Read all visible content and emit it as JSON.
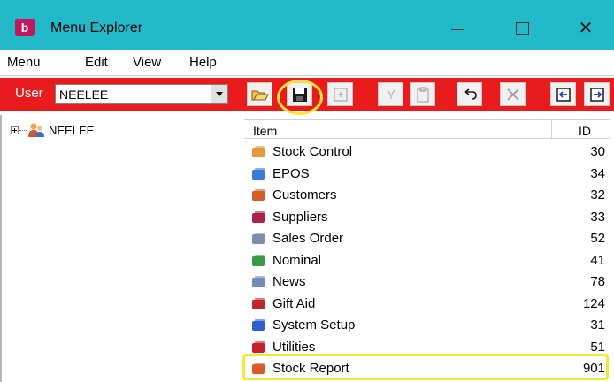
{
  "window": {
    "app_icon_letter": "b",
    "title": "Menu Explorer",
    "close_glyph": "✕"
  },
  "menubar": [
    "Menu",
    "Edit",
    "View",
    "Help"
  ],
  "toolbar": {
    "user_label": "User",
    "user_value": "NEELEE",
    "buttons": [
      "open-folder-icon",
      "save-icon",
      "new-item-icon",
      "filter-icon",
      "clipboard-icon",
      "undo-icon",
      "delete-icon",
      "import-icon",
      "export-icon"
    ]
  },
  "tree": {
    "root_label": "NEELEE"
  },
  "list": {
    "columns": {
      "item": "Item",
      "id": "ID"
    },
    "rows": [
      {
        "label": "Stock Control",
        "id": "30",
        "icon": "stock-control-icon",
        "color": "#e29a3b"
      },
      {
        "label": "EPOS",
        "id": "34",
        "icon": "epos-icon",
        "color": "#3a7bd5"
      },
      {
        "label": "Customers",
        "id": "32",
        "icon": "customers-icon",
        "color": "#d85c2a"
      },
      {
        "label": "Suppliers",
        "id": "33",
        "icon": "suppliers-icon",
        "color": "#b0204a"
      },
      {
        "label": "Sales Order",
        "id": "52",
        "icon": "sales-order-icon",
        "color": "#7a8fa8"
      },
      {
        "label": "Nominal",
        "id": "41",
        "icon": "nominal-icon",
        "color": "#3a9a47"
      },
      {
        "label": "News",
        "id": "78",
        "icon": "news-icon",
        "color": "#6f8fb8"
      },
      {
        "label": "Gift Aid",
        "id": "124",
        "icon": "gift-aid-icon",
        "color": "#c0262c"
      },
      {
        "label": "System Setup",
        "id": "31",
        "icon": "system-setup-icon",
        "color": "#2d5fcf"
      },
      {
        "label": "Utilities",
        "id": "51",
        "icon": "utilities-icon",
        "color": "#c8202a"
      },
      {
        "label": "Stock Report",
        "id": "901",
        "icon": "stock-report-icon",
        "color": "#d85c2a"
      }
    ]
  },
  "highlight_color": "#f3e637"
}
